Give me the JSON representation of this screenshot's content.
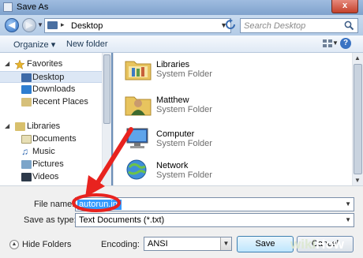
{
  "window": {
    "title": "Save As",
    "close_label": "x"
  },
  "navbar": {
    "back_icon": "back-arrow-icon",
    "forward_icon": "forward-arrow-icon",
    "address_path": "Desktop",
    "address_separator": "▸",
    "search_placeholder": "Search Desktop"
  },
  "toolbar": {
    "organize_label": "Organize ▾",
    "new_folder_label": "New folder",
    "help_label": "?"
  },
  "sidebar": {
    "favorites": {
      "label": "Favorites",
      "items": [
        {
          "label": "Desktop",
          "selected": true
        },
        {
          "label": "Downloads"
        },
        {
          "label": "Recent Places"
        }
      ]
    },
    "libraries": {
      "label": "Libraries",
      "items": [
        {
          "label": "Documents"
        },
        {
          "label": "Music"
        },
        {
          "label": "Pictures"
        },
        {
          "label": "Videos"
        }
      ]
    }
  },
  "main": {
    "items": [
      {
        "name": "Libraries",
        "type": "System Folder",
        "icon": "libraries-folder-icon"
      },
      {
        "name": "Matthew",
        "type": "System Folder",
        "icon": "user-folder-icon"
      },
      {
        "name": "Computer",
        "type": "System Folder",
        "icon": "computer-icon"
      },
      {
        "name": "Network",
        "type": "System Folder",
        "icon": "network-icon"
      }
    ]
  },
  "form": {
    "file_name_label": "File name:",
    "file_name_value": "autorun.inf",
    "save_as_type_label": "Save as type:",
    "save_as_type_value": "Text Documents (*.txt)",
    "hide_folders_label": "Hide Folders",
    "encoding_label": "Encoding:",
    "encoding_value": "ANSI",
    "save_label": "Save",
    "cancel_label": "Cancel"
  },
  "watermark": {
    "part1": "wiki",
    "part2": "How"
  },
  "colors": {
    "selection": "#3399ff",
    "annotation": "#e8231f"
  }
}
